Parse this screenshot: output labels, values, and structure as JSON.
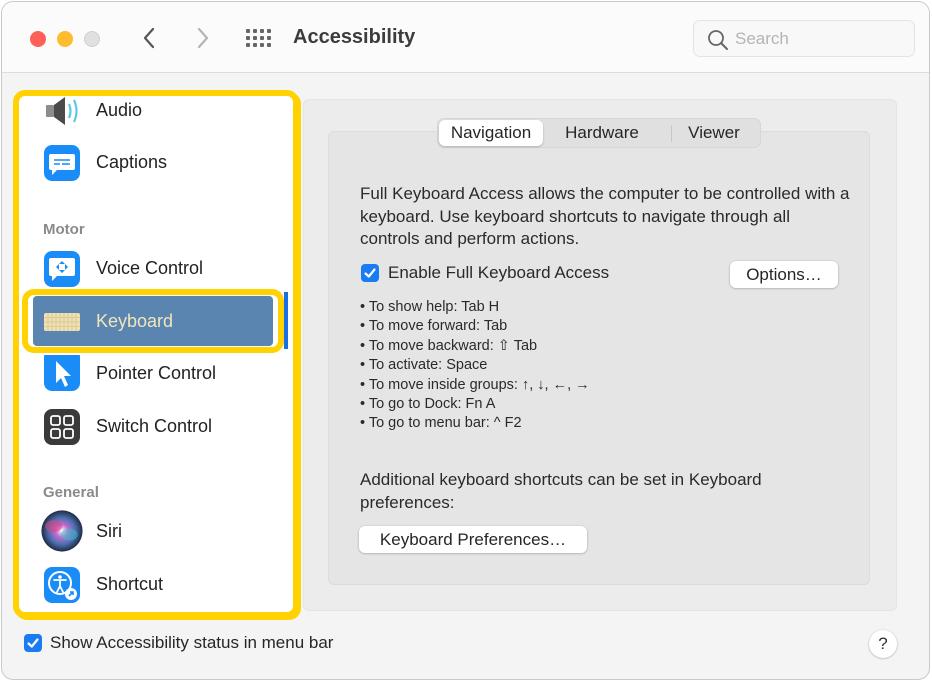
{
  "window": {
    "title": "Accessibility",
    "search": {
      "placeholder": "Search",
      "value": ""
    }
  },
  "toolbar": {
    "back_icon": "chevron-left-icon",
    "forward_icon": "chevron-right-icon",
    "show_all_icon": "grid-icon"
  },
  "sidebar": {
    "items_top": [
      {
        "label": "Audio",
        "icon": "speaker-icon"
      },
      {
        "label": "Captions",
        "icon": "captions-icon"
      }
    ],
    "sections": [
      {
        "title": "Motor",
        "items": [
          {
            "label": "Voice Control",
            "icon": "voice-control-icon"
          },
          {
            "label": "Keyboard",
            "icon": "keyboard-icon",
            "selected": true
          },
          {
            "label": "Pointer Control",
            "icon": "pointer-icon"
          },
          {
            "label": "Switch Control",
            "icon": "switch-control-icon"
          }
        ]
      },
      {
        "title": "General",
        "items": [
          {
            "label": "Siri",
            "icon": "siri-icon"
          },
          {
            "label": "Shortcut",
            "icon": "accessibility-shortcut-icon"
          }
        ]
      }
    ]
  },
  "tabs": [
    {
      "label": "Navigation",
      "selected": true
    },
    {
      "label": "Hardware",
      "selected": false
    },
    {
      "label": "Viewer",
      "selected": false
    }
  ],
  "navigation": {
    "description": "Full Keyboard Access allows the computer to be controlled with a keyboard. Use keyboard shortcuts to navigate through all controls and perform actions.",
    "enable_label": "Enable Full Keyboard Access",
    "enable_checked": true,
    "options_button": "Options…",
    "shortcuts": [
      "• To show help: Tab H",
      "• To move forward: Tab",
      "• To move backward: ⇧ Tab",
      "• To activate: Space",
      "• To move inside groups: ↑, ↓, ←, →",
      "• To go to Dock: Fn A",
      "• To go to menu bar: ^ F2"
    ],
    "additional_text": "Additional keyboard shortcuts can be set in Keyboard preferences:",
    "keyboard_prefs_button": "Keyboard Preferences…"
  },
  "footer": {
    "status_label": "Show Accessibility status in menu bar",
    "status_checked": true,
    "help_label": "?"
  },
  "colors": {
    "highlight": "#ffd200",
    "selected_row": "#5b85b1",
    "accent": "#1a7cf5"
  }
}
